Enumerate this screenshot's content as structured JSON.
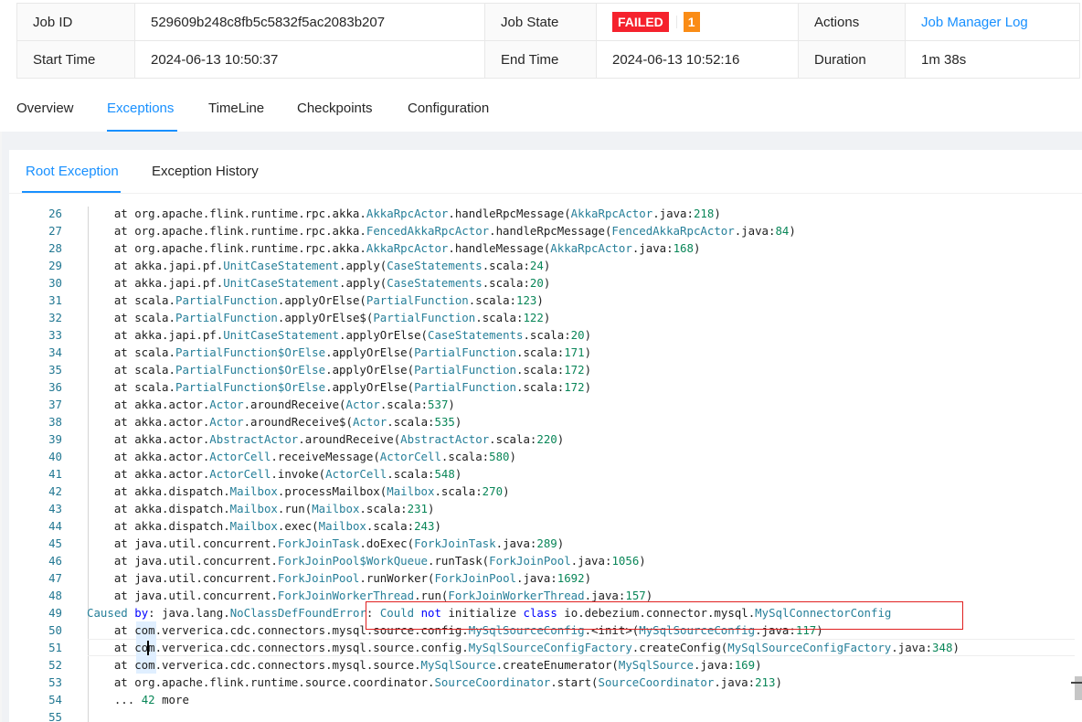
{
  "job_info": {
    "job_id_label": "Job ID",
    "job_id": "529609b248c8fb5c5832f5ac2083b207",
    "job_state_label": "Job State",
    "job_state": "FAILED",
    "failure_count": "1",
    "actions_label": "Actions",
    "job_manager_log": "Job Manager Log",
    "start_time_label": "Start Time",
    "start_time": "2024-06-13 10:50:37",
    "end_time_label": "End Time",
    "end_time": "2024-06-13 10:52:16",
    "duration_label": "Duration",
    "duration": "1m 38s"
  },
  "colors": {
    "accent": "#1890ff",
    "failed": "#f5222d",
    "count": "#fa8c16"
  },
  "tabs": [
    {
      "label": "Overview",
      "active": false
    },
    {
      "label": "Exceptions",
      "active": true
    },
    {
      "label": "TimeLine",
      "active": false
    },
    {
      "label": "Checkpoints",
      "active": false
    },
    {
      "label": "Configuration",
      "active": false
    }
  ],
  "subtabs": [
    {
      "label": "Root Exception",
      "active": true
    },
    {
      "label": "Exception History",
      "active": false
    }
  ],
  "editor": {
    "current_line": 51,
    "lines": [
      {
        "n": "26",
        "t": [
          [
            "p",
            "    at org.apache.flink.runtime.rpc.akka."
          ],
          [
            "c",
            "AkkaRpcActor"
          ],
          [
            "p",
            ".handleRpcMessage("
          ],
          [
            "c",
            "AkkaRpcActor"
          ],
          [
            "p",
            ".java:"
          ],
          [
            "d",
            "218"
          ],
          [
            "p",
            ")"
          ]
        ]
      },
      {
        "n": "27",
        "t": [
          [
            "p",
            "    at org.apache.flink.runtime.rpc.akka."
          ],
          [
            "c",
            "FencedAkkaRpcActor"
          ],
          [
            "p",
            ".handleRpcMessage("
          ],
          [
            "c",
            "FencedAkkaRpcActor"
          ],
          [
            "p",
            ".java:"
          ],
          [
            "d",
            "84"
          ],
          [
            "p",
            ")"
          ]
        ]
      },
      {
        "n": "28",
        "t": [
          [
            "p",
            "    at org.apache.flink.runtime.rpc.akka."
          ],
          [
            "c",
            "AkkaRpcActor"
          ],
          [
            "p",
            ".handleMessage("
          ],
          [
            "c",
            "AkkaRpcActor"
          ],
          [
            "p",
            ".java:"
          ],
          [
            "d",
            "168"
          ],
          [
            "p",
            ")"
          ]
        ]
      },
      {
        "n": "29",
        "t": [
          [
            "p",
            "    at akka.japi.pf."
          ],
          [
            "c",
            "UnitCaseStatement"
          ],
          [
            "p",
            ".apply("
          ],
          [
            "c",
            "CaseStatements"
          ],
          [
            "p",
            ".scala:"
          ],
          [
            "d",
            "24"
          ],
          [
            "p",
            ")"
          ]
        ]
      },
      {
        "n": "30",
        "t": [
          [
            "p",
            "    at akka.japi.pf."
          ],
          [
            "c",
            "UnitCaseStatement"
          ],
          [
            "p",
            ".apply("
          ],
          [
            "c",
            "CaseStatements"
          ],
          [
            "p",
            ".scala:"
          ],
          [
            "d",
            "20"
          ],
          [
            "p",
            ")"
          ]
        ]
      },
      {
        "n": "31",
        "t": [
          [
            "p",
            "    at scala."
          ],
          [
            "c",
            "PartialFunction"
          ],
          [
            "p",
            ".applyOrElse("
          ],
          [
            "c",
            "PartialFunction"
          ],
          [
            "p",
            ".scala:"
          ],
          [
            "d",
            "123"
          ],
          [
            "p",
            ")"
          ]
        ]
      },
      {
        "n": "32",
        "t": [
          [
            "p",
            "    at scala."
          ],
          [
            "c",
            "PartialFunction"
          ],
          [
            "p",
            ".applyOrElse$("
          ],
          [
            "c",
            "PartialFunction"
          ],
          [
            "p",
            ".scala:"
          ],
          [
            "d",
            "122"
          ],
          [
            "p",
            ")"
          ]
        ]
      },
      {
        "n": "33",
        "t": [
          [
            "p",
            "    at akka.japi.pf."
          ],
          [
            "c",
            "UnitCaseStatement"
          ],
          [
            "p",
            ".applyOrElse("
          ],
          [
            "c",
            "CaseStatements"
          ],
          [
            "p",
            ".scala:"
          ],
          [
            "d",
            "20"
          ],
          [
            "p",
            ")"
          ]
        ]
      },
      {
        "n": "34",
        "t": [
          [
            "p",
            "    at scala."
          ],
          [
            "c",
            "PartialFunction$OrElse"
          ],
          [
            "p",
            ".applyOrElse("
          ],
          [
            "c",
            "PartialFunction"
          ],
          [
            "p",
            ".scala:"
          ],
          [
            "d",
            "171"
          ],
          [
            "p",
            ")"
          ]
        ]
      },
      {
        "n": "35",
        "t": [
          [
            "p",
            "    at scala."
          ],
          [
            "c",
            "PartialFunction$OrElse"
          ],
          [
            "p",
            ".applyOrElse("
          ],
          [
            "c",
            "PartialFunction"
          ],
          [
            "p",
            ".scala:"
          ],
          [
            "d",
            "172"
          ],
          [
            "p",
            ")"
          ]
        ]
      },
      {
        "n": "36",
        "t": [
          [
            "p",
            "    at scala."
          ],
          [
            "c",
            "PartialFunction$OrElse"
          ],
          [
            "p",
            ".applyOrElse("
          ],
          [
            "c",
            "PartialFunction"
          ],
          [
            "p",
            ".scala:"
          ],
          [
            "d",
            "172"
          ],
          [
            "p",
            ")"
          ]
        ]
      },
      {
        "n": "37",
        "t": [
          [
            "p",
            "    at akka.actor."
          ],
          [
            "c",
            "Actor"
          ],
          [
            "p",
            ".aroundReceive("
          ],
          [
            "c",
            "Actor"
          ],
          [
            "p",
            ".scala:"
          ],
          [
            "d",
            "537"
          ],
          [
            "p",
            ")"
          ]
        ]
      },
      {
        "n": "38",
        "t": [
          [
            "p",
            "    at akka.actor."
          ],
          [
            "c",
            "Actor"
          ],
          [
            "p",
            ".aroundReceive$("
          ],
          [
            "c",
            "Actor"
          ],
          [
            "p",
            ".scala:"
          ],
          [
            "d",
            "535"
          ],
          [
            "p",
            ")"
          ]
        ]
      },
      {
        "n": "39",
        "t": [
          [
            "p",
            "    at akka.actor."
          ],
          [
            "c",
            "AbstractActor"
          ],
          [
            "p",
            ".aroundReceive("
          ],
          [
            "c",
            "AbstractActor"
          ],
          [
            "p",
            ".scala:"
          ],
          [
            "d",
            "220"
          ],
          [
            "p",
            ")"
          ]
        ]
      },
      {
        "n": "40",
        "t": [
          [
            "p",
            "    at akka.actor."
          ],
          [
            "c",
            "ActorCell"
          ],
          [
            "p",
            ".receiveMessage("
          ],
          [
            "c",
            "ActorCell"
          ],
          [
            "p",
            ".scala:"
          ],
          [
            "d",
            "580"
          ],
          [
            "p",
            ")"
          ]
        ]
      },
      {
        "n": "41",
        "t": [
          [
            "p",
            "    at akka.actor."
          ],
          [
            "c",
            "ActorCell"
          ],
          [
            "p",
            ".invoke("
          ],
          [
            "c",
            "ActorCell"
          ],
          [
            "p",
            ".scala:"
          ],
          [
            "d",
            "548"
          ],
          [
            "p",
            ")"
          ]
        ]
      },
      {
        "n": "42",
        "t": [
          [
            "p",
            "    at akka.dispatch."
          ],
          [
            "c",
            "Mailbox"
          ],
          [
            "p",
            ".processMailbox("
          ],
          [
            "c",
            "Mailbox"
          ],
          [
            "p",
            ".scala:"
          ],
          [
            "d",
            "270"
          ],
          [
            "p",
            ")"
          ]
        ]
      },
      {
        "n": "43",
        "t": [
          [
            "p",
            "    at akka.dispatch."
          ],
          [
            "c",
            "Mailbox"
          ],
          [
            "p",
            ".run("
          ],
          [
            "c",
            "Mailbox"
          ],
          [
            "p",
            ".scala:"
          ],
          [
            "d",
            "231"
          ],
          [
            "p",
            ")"
          ]
        ]
      },
      {
        "n": "44",
        "t": [
          [
            "p",
            "    at akka.dispatch."
          ],
          [
            "c",
            "Mailbox"
          ],
          [
            "p",
            ".exec("
          ],
          [
            "c",
            "Mailbox"
          ],
          [
            "p",
            ".scala:"
          ],
          [
            "d",
            "243"
          ],
          [
            "p",
            ")"
          ]
        ]
      },
      {
        "n": "45",
        "t": [
          [
            "p",
            "    at java.util.concurrent."
          ],
          [
            "c",
            "ForkJoinTask"
          ],
          [
            "p",
            ".doExec("
          ],
          [
            "c",
            "ForkJoinTask"
          ],
          [
            "p",
            ".java:"
          ],
          [
            "d",
            "289"
          ],
          [
            "p",
            ")"
          ]
        ]
      },
      {
        "n": "46",
        "t": [
          [
            "p",
            "    at java.util.concurrent."
          ],
          [
            "c",
            "ForkJoinPool$WorkQueue"
          ],
          [
            "p",
            ".runTask("
          ],
          [
            "c",
            "ForkJoinPool"
          ],
          [
            "p",
            ".java:"
          ],
          [
            "d",
            "1056"
          ],
          [
            "p",
            ")"
          ]
        ]
      },
      {
        "n": "47",
        "t": [
          [
            "p",
            "    at java.util.concurrent."
          ],
          [
            "c",
            "ForkJoinPool"
          ],
          [
            "p",
            ".runWorker("
          ],
          [
            "c",
            "ForkJoinPool"
          ],
          [
            "p",
            ".java:"
          ],
          [
            "d",
            "1692"
          ],
          [
            "p",
            ")"
          ]
        ]
      },
      {
        "n": "48",
        "t": [
          [
            "p",
            "    at java.util.concurrent."
          ],
          [
            "c",
            "ForkJoinWorkerThread"
          ],
          [
            "p",
            ".run("
          ],
          [
            "c",
            "ForkJoinWorkerThread"
          ],
          [
            "p",
            ".java:"
          ],
          [
            "d",
            "157"
          ],
          [
            "p",
            ")"
          ]
        ]
      },
      {
        "n": "49",
        "t": [
          [
            "c",
            "Caused"
          ],
          [
            "p",
            " "
          ],
          [
            "k",
            "by"
          ],
          [
            "p",
            ": java.lang."
          ],
          [
            "c",
            "NoClassDefFoundError"
          ],
          [
            "p",
            ": "
          ],
          [
            "c",
            "Could"
          ],
          [
            "p",
            " "
          ],
          [
            "k",
            "not"
          ],
          [
            "p",
            " initialize "
          ],
          [
            "k",
            "class"
          ],
          [
            "p",
            " io.debezium.connector.mysql."
          ],
          [
            "c",
            "MySqlConnectorConfig"
          ]
        ]
      },
      {
        "n": "50",
        "t": [
          [
            "p",
            "    at com.ververica.cdc.connectors.mysql.source.config."
          ],
          [
            "c",
            "MySqlSourceConfig"
          ],
          [
            "p",
            ".<init>("
          ],
          [
            "c",
            "MySqlSourceConfig"
          ],
          [
            "p",
            ".java:"
          ],
          [
            "d",
            "117"
          ],
          [
            "p",
            ")"
          ]
        ]
      },
      {
        "n": "51",
        "t": [
          [
            "p",
            "    at com.ververica.cdc.connectors.mysql.source.config."
          ],
          [
            "c",
            "MySqlSourceConfigFactory"
          ],
          [
            "p",
            ".createConfig("
          ],
          [
            "c",
            "MySqlSourceConfigFactory"
          ],
          [
            "p",
            ".java:"
          ],
          [
            "d",
            "348"
          ],
          [
            "p",
            ")"
          ]
        ]
      },
      {
        "n": "52",
        "t": [
          [
            "p",
            "    at com.ververica.cdc.connectors.mysql.source."
          ],
          [
            "c",
            "MySqlSource"
          ],
          [
            "p",
            ".createEnumerator("
          ],
          [
            "c",
            "MySqlSource"
          ],
          [
            "p",
            ".java:"
          ],
          [
            "d",
            "169"
          ],
          [
            "p",
            ")"
          ]
        ]
      },
      {
        "n": "53",
        "t": [
          [
            "p",
            "    at org.apache.flink.runtime.source.coordinator."
          ],
          [
            "c",
            "SourceCoordinator"
          ],
          [
            "p",
            ".start("
          ],
          [
            "c",
            "SourceCoordinator"
          ],
          [
            "p",
            ".java:"
          ],
          [
            "d",
            "213"
          ],
          [
            "p",
            ")"
          ]
        ]
      },
      {
        "n": "54",
        "t": [
          [
            "p",
            "    ... "
          ],
          [
            "d",
            "42"
          ],
          [
            "p",
            " more"
          ]
        ]
      },
      {
        "n": "55",
        "t": []
      }
    ]
  }
}
